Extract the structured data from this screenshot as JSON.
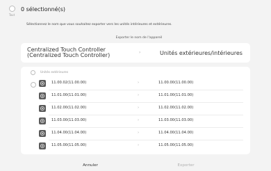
{
  "header": {
    "select_all_label": "Tout",
    "title": "0 sélectionné(s)"
  },
  "instruction": "Sélectionnez le nom que vous souhaitez exporter vers les unités intérieures et extérieures.",
  "sub_header": "Exporter le nom de l'appareil",
  "header_row": {
    "source": "Centralized Touch Controller (Centralized Touch Controller)",
    "chevron": "›",
    "target": "Unités extérieures/intérieures"
  },
  "group_label": "Unités extérieures",
  "rows": [
    {
      "source": "11.00.02(11.00.00)",
      "chevron": "›",
      "target": "11.00.00(11.00.00)"
    },
    {
      "source": "11.01.00(11.01.00)",
      "chevron": "›",
      "target": "11.01.00(11.01.00)"
    },
    {
      "source": "11.02.00(11.02.00)",
      "chevron": "›",
      "target": "11.02.00(11.02.00)"
    },
    {
      "source": "11.03.00(11.03.00)",
      "chevron": "›",
      "target": "11.03.00(11.03.00)"
    },
    {
      "source": "11.04.00(11.04.00)",
      "chevron": "›",
      "target": "11.04.00(11.04.00)"
    },
    {
      "source": "11.05.00(11.05.00)",
      "chevron": "›",
      "target": "11.05.00(11.05.00)"
    }
  ],
  "footer": {
    "cancel_label": "Annuler",
    "export_label": "Exporter"
  },
  "icons": {
    "unit": "indoor-unit-icon",
    "chevron": "chevron-right-icon"
  }
}
